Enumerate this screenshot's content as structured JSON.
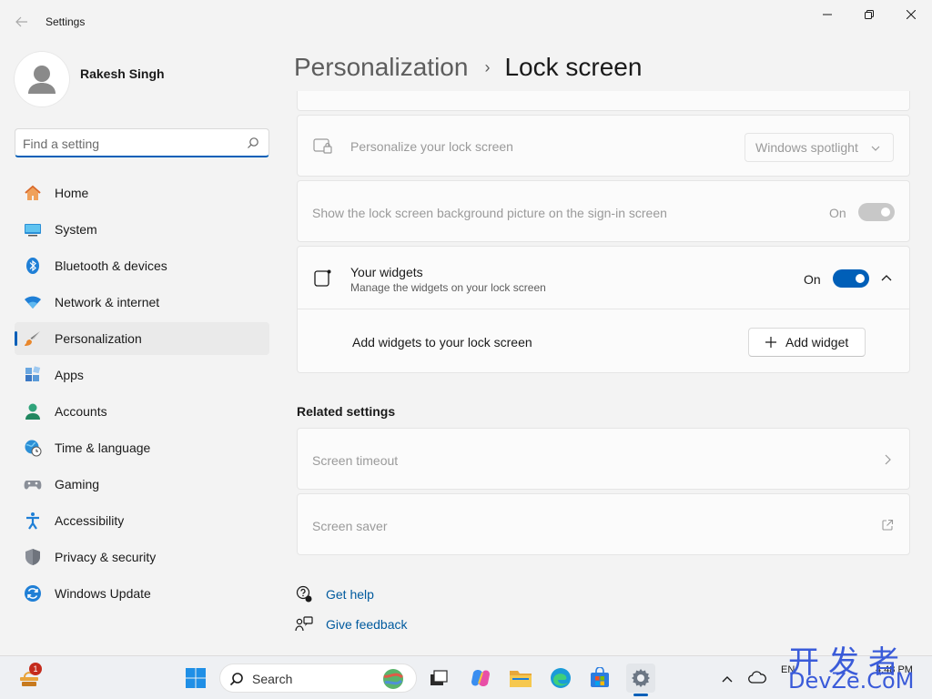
{
  "window": {
    "app_title": "Settings"
  },
  "user": {
    "name": "Rakesh Singh"
  },
  "search": {
    "placeholder": "Find a setting"
  },
  "sidebar": {
    "items": [
      {
        "label": "Home",
        "icon": "home-icon"
      },
      {
        "label": "System",
        "icon": "system-icon"
      },
      {
        "label": "Bluetooth & devices",
        "icon": "bluetooth-icon"
      },
      {
        "label": "Network & internet",
        "icon": "wifi-icon"
      },
      {
        "label": "Personalization",
        "icon": "paintbrush-icon",
        "selected": true
      },
      {
        "label": "Apps",
        "icon": "apps-icon"
      },
      {
        "label": "Accounts",
        "icon": "accounts-icon"
      },
      {
        "label": "Time & language",
        "icon": "globe-clock-icon"
      },
      {
        "label": "Gaming",
        "icon": "gamepad-icon"
      },
      {
        "label": "Accessibility",
        "icon": "accessibility-icon"
      },
      {
        "label": "Privacy & security",
        "icon": "shield-icon"
      },
      {
        "label": "Windows Update",
        "icon": "update-icon"
      }
    ]
  },
  "breadcrumb": {
    "parent": "Personalization",
    "separator": "›",
    "current": "Lock screen"
  },
  "settings": {
    "personalize_label": "Personalize your lock screen",
    "personalize_value": "Windows spotlight",
    "signin_bg_label": "Show the lock screen background picture on the sign-in screen",
    "signin_bg_state": "On",
    "widgets_label": "Your widgets",
    "widgets_sub": "Manage the widgets on your lock screen",
    "widgets_state": "On",
    "add_widgets_label": "Add widgets to your lock screen",
    "add_widget_button": "Add widget"
  },
  "related": {
    "title": "Related settings",
    "screen_timeout": "Screen timeout",
    "screen_saver": "Screen saver"
  },
  "help": {
    "get_help": "Get help",
    "give_feedback": "Give feedback"
  },
  "taskbar": {
    "search_label": "Search",
    "notification_count": "1",
    "tray_lang": "EN",
    "tray_time": "4:48 PM"
  },
  "watermark": {
    "top": "开发者",
    "bottom": "DevZe.CoM"
  },
  "colors": {
    "accent": "#005fb8",
    "link": "#005a9e",
    "disabled_text": "#9a9a9a"
  }
}
